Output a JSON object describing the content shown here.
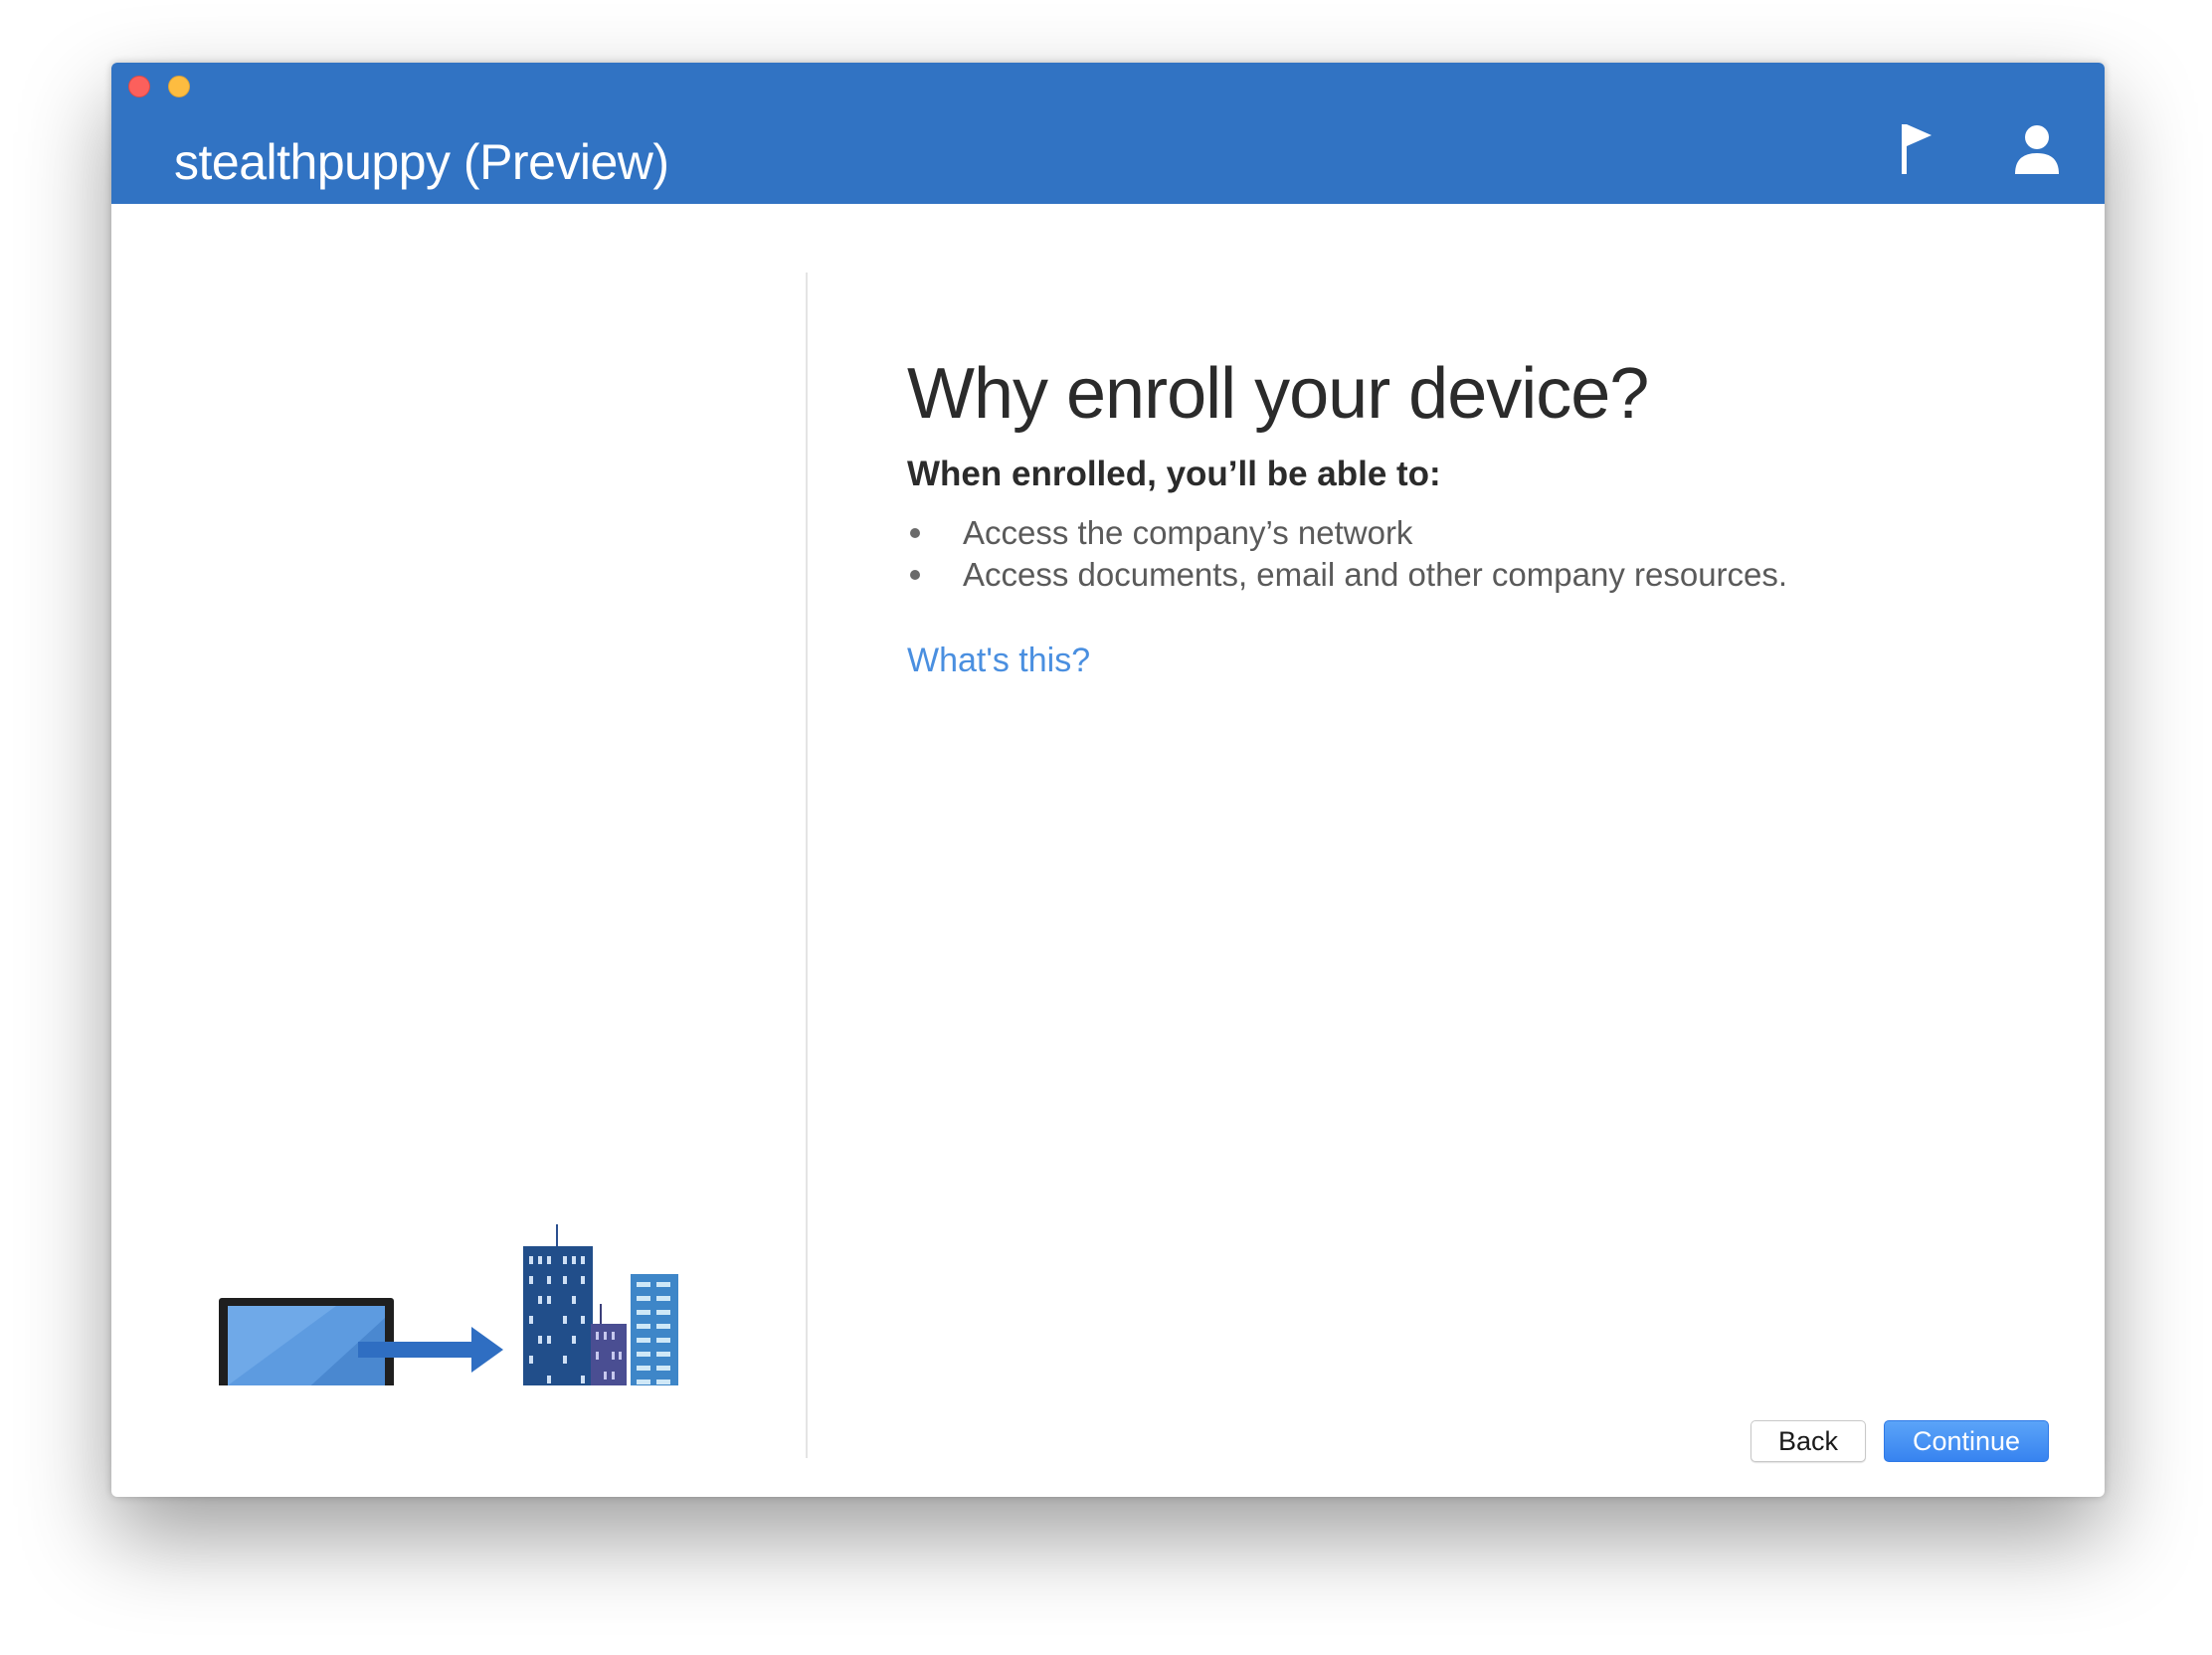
{
  "window": {
    "title": "stealthpuppy (Preview)"
  },
  "header": {
    "icons": [
      "flag-icon",
      "user-icon"
    ]
  },
  "main": {
    "heading": "Why enroll your device?",
    "subheading": "When enrolled, you’ll be able to:",
    "benefits": [
      "Access the company’s network",
      "Access documents, email and other company resources."
    ],
    "help_link": "What's this?"
  },
  "footer": {
    "back_label": "Back",
    "continue_label": "Continue"
  },
  "colors": {
    "titlebar": "#3173c3",
    "link": "#4a8fe0",
    "primary_button": "#3783f0"
  }
}
